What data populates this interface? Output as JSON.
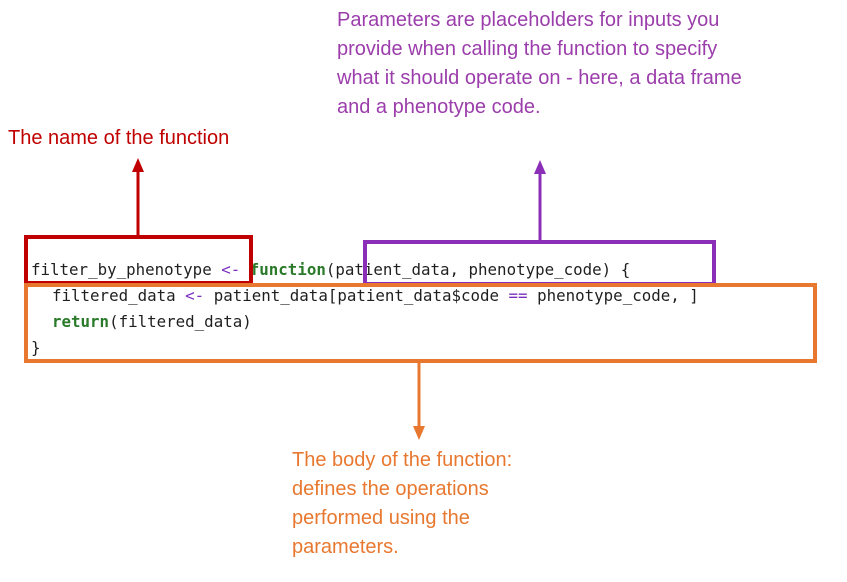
{
  "annotations": {
    "function_name": "The name of the function",
    "parameters": "Parameters are placeholders for inputs you provide when calling the function to specify what it should operate on - here, a data frame and a phenotype code.",
    "body": "The body of the function: defines the operations performed using the parameters."
  },
  "code": {
    "function_name": "filter_by_phenotype",
    "assign_op": "<-",
    "function_keyword": "function",
    "params_open": "(",
    "params": "patient_data, phenotype_code",
    "params_close": ")",
    "brace_open": "{",
    "body_line1_var": "filtered_data",
    "body_line1_assign": "<-",
    "body_line1_expr_a": "patient_data[patient_data$code",
    "body_line1_eq": "==",
    "body_line1_expr_b": "phenotype_code, ]",
    "body_line2_keyword": "return",
    "body_line2_arg": "(filtered_data)",
    "brace_close": "}"
  },
  "colors": {
    "name_red": "#c00000",
    "params_purple": "#8b2fb8",
    "params_text_purple": "#9b3dab",
    "body_orange": "#e8782f",
    "operator_purple": "#7a2fbf",
    "keyword_green": "#2a7a2a"
  }
}
